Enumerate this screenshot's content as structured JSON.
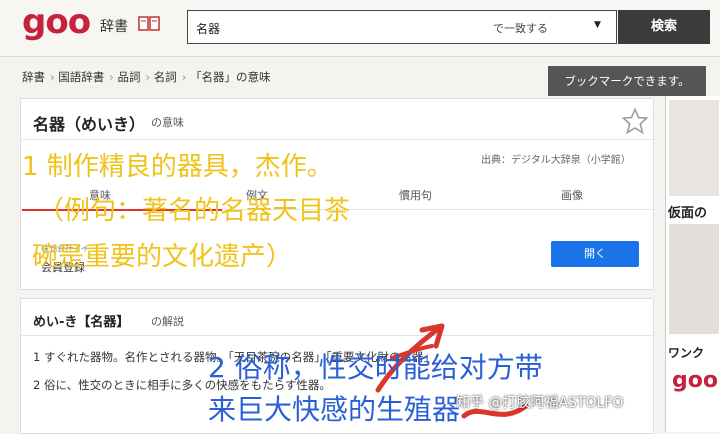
{
  "header": {
    "logo": "goo",
    "dict_label": "辞書",
    "search_value": "名器",
    "search_mode": "で一致する",
    "search_button": "検索"
  },
  "breadcrumb": [
    "辞書",
    "国語辞書",
    "品詞",
    "名詞",
    "「名器」の意味"
  ],
  "toast": "ブックマークできます。",
  "entry": {
    "title": "名器（めいき）",
    "suffix": "の意味",
    "source": "出典：デジタル大辞泉（小学館）",
    "tabs": [
      "意味",
      "例文",
      "慣用句",
      "画像"
    ]
  },
  "ad": {
    "small": "株式会社アイ",
    "text": "会員登録",
    "button": "開く"
  },
  "explanation": {
    "title": "めい‐き【名器】",
    "suffix": "の解説",
    "defs": [
      "1 すぐれた器物。名作とされる器物。「天目茶碗の名器」「重要文化財の名器」",
      "2 俗に、性交のときに相手に多くの快感をもたらす性器。"
    ]
  },
  "side_ad": {
    "title": "仮面の",
    "wank": "ワンク",
    "logo": "goo"
  },
  "overlay": {
    "line1": "1 制作精良的器具，杰作。",
    "line2": "（例句：著名的名器天目茶",
    "line3": "碗是重要的文化遗产）",
    "line4": "2 俗称，性交时能给对方带",
    "line5": "来巨大快感的生殖器"
  },
  "watermark": "知乎 @打胶阿福ASTOLFO",
  "colors": {
    "brand": "#c5223d",
    "overlay_yellow": "#f0c31a",
    "overlay_blue": "#2a5fd8",
    "button_blue": "#1a73e8"
  }
}
